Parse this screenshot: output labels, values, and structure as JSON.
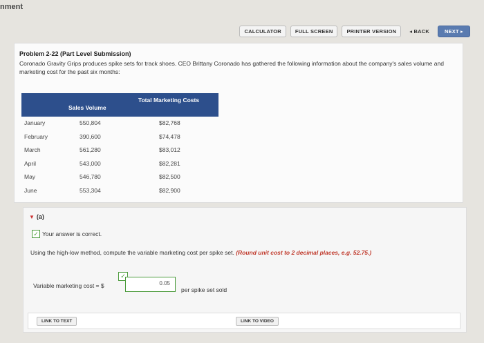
{
  "page_label": "nment",
  "toolbar": {
    "calculator": "CALCULATOR",
    "full_screen": "FULL SCREEN",
    "printer_version": "PRINTER VERSION",
    "back": "◂ BACK",
    "next": "NEXT ▸"
  },
  "problem": {
    "title": "Problem 2-22 (Part Level Submission)",
    "description": "Coronado Gravity Grips produces spike sets for track shoes. CEO Brittany Coronado has gathered the following information about the company's sales volume and marketing cost for the past six months:"
  },
  "table": {
    "col_sales": "Sales Volume",
    "col_cost": "Total Marketing Costs",
    "rows": [
      {
        "month": "January",
        "sales": "550,804",
        "cost": "$82,768"
      },
      {
        "month": "February",
        "sales": "390,600",
        "cost": "$74,478"
      },
      {
        "month": "March",
        "sales": "561,280",
        "cost": "$83,012"
      },
      {
        "month": "April",
        "sales": "543,000",
        "cost": "$82,281"
      },
      {
        "month": "May",
        "sales": "546,780",
        "cost": "$82,500"
      },
      {
        "month": "June",
        "sales": "553,304",
        "cost": "$82,900"
      }
    ]
  },
  "part_a": {
    "label": "(a)",
    "status": "Your answer is correct.",
    "instruction": "Using the high-low method, compute the variable marketing cost per spike set.",
    "rounding_note": "(Round unit cost to 2 decimal places, e.g. 52.75.)",
    "field_label": "Variable marketing cost  =  $",
    "answer_value": "0.05",
    "unit_suffix": "per spike set sold",
    "link_text": "LINK TO TEXT",
    "link_video": "LINK TO VIDEO"
  },
  "colors": {
    "header_blue": "#2d4f8c",
    "correct_green": "#4a9a3a",
    "hint_red": "#c0392b"
  }
}
